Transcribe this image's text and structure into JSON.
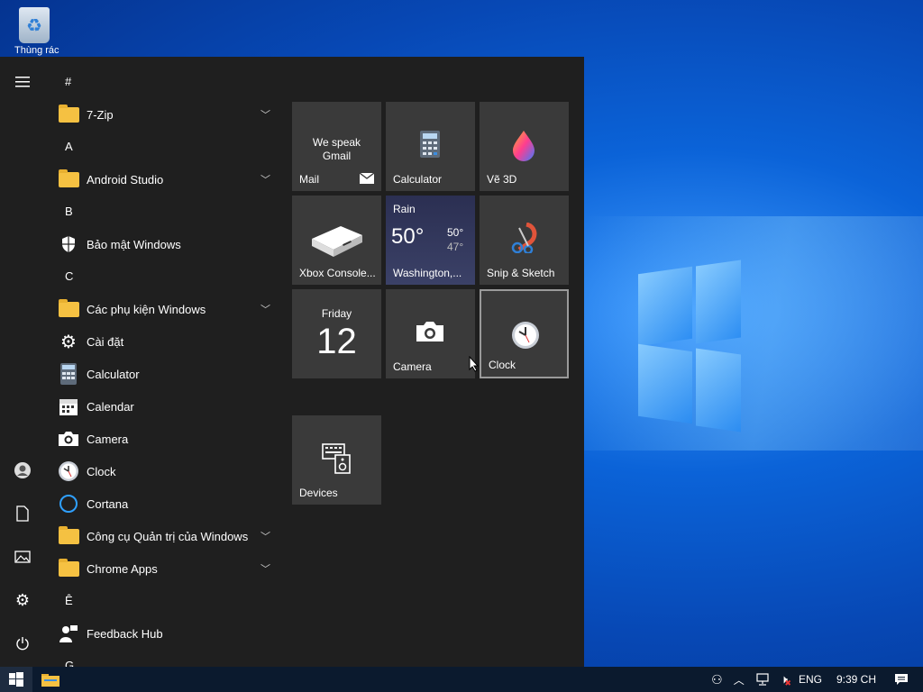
{
  "desktop": {
    "recycle_bin_label": "Thùng rác"
  },
  "rail": {
    "menu": "hamburger-icon",
    "user": "user-icon",
    "documents": "document-icon",
    "pictures": "picture-icon",
    "settings": "gear-icon",
    "power": "power-icon"
  },
  "app_list": [
    {
      "type": "letter",
      "text": "#"
    },
    {
      "type": "app",
      "label": "7-Zip",
      "icon": "folder",
      "expandable": true
    },
    {
      "type": "letter",
      "text": "A"
    },
    {
      "type": "app",
      "label": "Android Studio",
      "icon": "folder",
      "expandable": true
    },
    {
      "type": "letter",
      "text": "B"
    },
    {
      "type": "app",
      "label": "Bảo mật Windows",
      "icon": "shield",
      "expandable": false
    },
    {
      "type": "letter",
      "text": "C"
    },
    {
      "type": "app",
      "label": "Các phụ kiện Windows",
      "icon": "folder",
      "expandable": true
    },
    {
      "type": "app",
      "label": "Cài đặt",
      "icon": "gear",
      "expandable": false
    },
    {
      "type": "app",
      "label": "Calculator",
      "icon": "calculator",
      "expandable": false
    },
    {
      "type": "app",
      "label": "Calendar",
      "icon": "calendar",
      "expandable": false
    },
    {
      "type": "app",
      "label": "Camera",
      "icon": "camera",
      "expandable": false
    },
    {
      "type": "app",
      "label": "Clock",
      "icon": "clock",
      "expandable": false
    },
    {
      "type": "app",
      "label": "Cortana",
      "icon": "cortana",
      "expandable": false
    },
    {
      "type": "app",
      "label": "Công cụ Quản trị của Windows",
      "icon": "folder",
      "expandable": true
    },
    {
      "type": "app",
      "label": "Chrome Apps",
      "icon": "folder",
      "expandable": true
    },
    {
      "type": "letter",
      "text": "Ê"
    },
    {
      "type": "app",
      "label": "Feedback Hub",
      "icon": "feedback",
      "expandable": false
    },
    {
      "type": "letter",
      "text": "G"
    }
  ],
  "tiles": {
    "mail": {
      "label": "Mail",
      "text": "We speak Gmail"
    },
    "calculator": {
      "label": "Calculator"
    },
    "paint3d": {
      "label": "Vẽ 3D"
    },
    "xbox": {
      "label": "Xbox Console..."
    },
    "weather": {
      "condition": "Rain",
      "temp": "50°",
      "high": "50°",
      "low": "47°",
      "location": "Washington,..."
    },
    "snip": {
      "label": "Snip & Sketch"
    },
    "calendar": {
      "day": "Friday",
      "date": "12"
    },
    "camera": {
      "label": "Camera"
    },
    "clock": {
      "label": "Clock"
    },
    "devices": {
      "label": "Devices"
    }
  },
  "taskbar": {
    "language": "ENG",
    "time": "9:39 CH"
  },
  "colors": {
    "start_bg": "#1f1f1f",
    "tile_bg": "#3a3a3a",
    "taskbar_bg": "#0b1a2e",
    "folder": "#f5c142"
  }
}
